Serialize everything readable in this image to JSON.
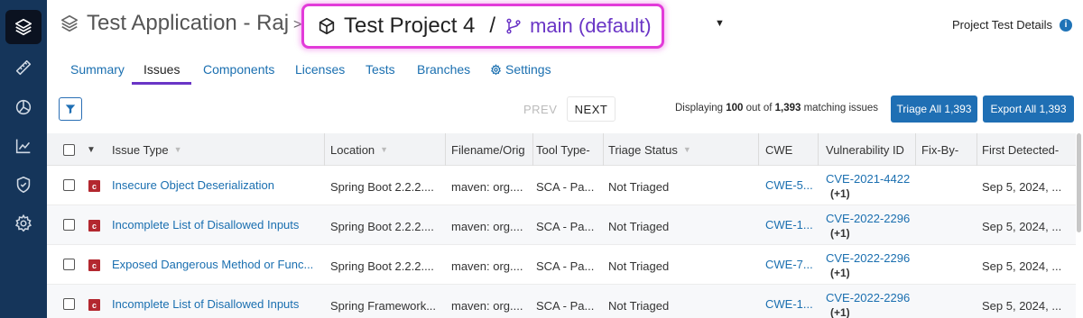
{
  "header": {
    "app_title": "Test Application - Raj",
    "crumb_sep": ">",
    "project": "Test Project 4",
    "separator": "/",
    "branch": "main (default)",
    "details_label": "Project Test Details"
  },
  "tabs": [
    {
      "label": "Summary"
    },
    {
      "label": "Issues"
    },
    {
      "label": "Components"
    },
    {
      "label": "Licenses"
    },
    {
      "label": "Tests"
    },
    {
      "label": "Branches"
    },
    {
      "label": "Settings"
    }
  ],
  "toolbar": {
    "prev": "PREV",
    "next": "NEXT",
    "display_prefix": "Displaying ",
    "display_count": "100",
    "display_mid": " out of ",
    "display_total": "1,393",
    "display_suffix": " matching issues",
    "triage_all": "Triage All 1,393",
    "export_all": "Export All 1,393"
  },
  "columns": [
    "Issue Type",
    "Location",
    "Filename/Orig",
    "Tool Type-",
    "Triage Status",
    "CWE",
    "Vulnerability ID",
    "Fix-By-",
    "First Detected-"
  ],
  "rows": [
    {
      "severity": "c",
      "issue_type": "Insecure Object Deserialization",
      "location": "Spring Boot 2.2.2....",
      "filename": "maven: org....",
      "tool_type": "SCA - Pa...",
      "triage_status": "Not Triaged",
      "cwe": "CWE-5...",
      "vuln_id": "CVE-2021-4422",
      "vuln_extra": "(+1)",
      "fix_by": "",
      "first_detected": "Sep 5, 2024, ..."
    },
    {
      "severity": "c",
      "issue_type": "Incomplete List of Disallowed Inputs",
      "location": "Spring Boot 2.2.2....",
      "filename": "maven: org....",
      "tool_type": "SCA - Pa...",
      "triage_status": "Not Triaged",
      "cwe": "CWE-1...",
      "vuln_id": "CVE-2022-2296",
      "vuln_extra": "(+1)",
      "fix_by": "",
      "first_detected": "Sep 5, 2024, ..."
    },
    {
      "severity": "c",
      "issue_type": "Exposed Dangerous Method or Func...",
      "location": "Spring Boot 2.2.2....",
      "filename": "maven: org....",
      "tool_type": "SCA - Pa...",
      "triage_status": "Not Triaged",
      "cwe": "CWE-7...",
      "vuln_id": "CVE-2022-2296",
      "vuln_extra": "(+1)",
      "fix_by": "",
      "first_detected": "Sep 5, 2024, ..."
    },
    {
      "severity": "c",
      "issue_type": "Incomplete List of Disallowed Inputs",
      "location": "Spring Framework...",
      "filename": "maven: org....",
      "tool_type": "SCA - Pa...",
      "triage_status": "Not Triaged",
      "cwe": "CWE-1...",
      "vuln_id": "CVE-2022-2296",
      "vuln_extra": "(+1)",
      "fix_by": "",
      "first_detected": "Sep 5, 2024, ..."
    }
  ],
  "colors": {
    "nav_bg": "#15355a",
    "accent_purple": "#6a35c6",
    "highlight_pink": "#e23bd9",
    "link_blue": "#1a6fb0",
    "button_blue": "#1f6fb4",
    "severity_red": "#b3272f"
  },
  "nav_icons": [
    "layers-icon",
    "ruler-icon",
    "pie-chart-icon",
    "trend-chart-icon",
    "shield-check-icon",
    "gear-icon"
  ]
}
